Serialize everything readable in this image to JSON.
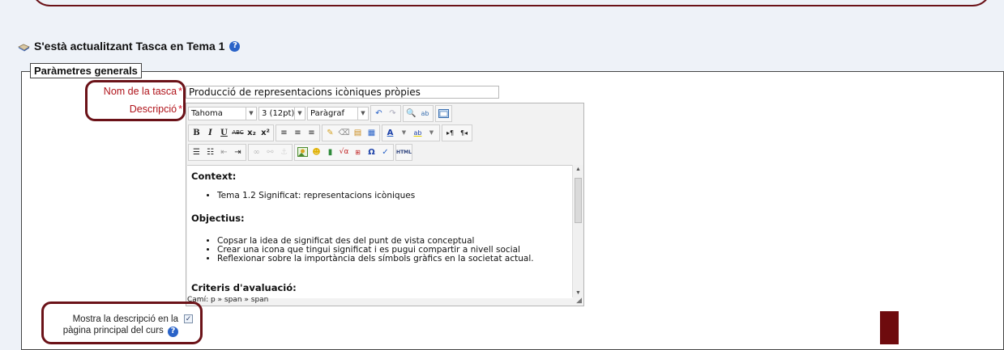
{
  "page": {
    "heading": "S'està actualitzant Tasca en Tema 1",
    "fieldset_legend": "Paràmetres generals"
  },
  "form": {
    "name_label": "Nom de la tasca",
    "name_required": "*",
    "name_value": "Producció de representacions icòniques pròpies",
    "description_label": "Descripció",
    "description_required": "*",
    "show_description_label_line1": "Mostra la descripció en la",
    "show_description_label_line2": "pàgina principal del curs",
    "show_description_checked": true
  },
  "editor": {
    "toolbar": {
      "font_family": "Tahoma",
      "font_size": "3 (12pt)",
      "block_format": "Paràgraf"
    },
    "content": {
      "section1_heading": "Context:",
      "section1_items": [
        "Tema 1.2 Significat: representacions icòniques"
      ],
      "section2_heading": "Objectius:",
      "section2_items": [
        "Copsar la idea de significat des del punt de vista conceptual",
        "Crear una icona que tingui significat i es pugui compartir a nivell social",
        "Reflexionar sobre la importància dels símbols gràfics en la societat actual."
      ],
      "section3_heading": "Criteris d'avaluació:"
    },
    "status_path": "Camí: p » span » span"
  },
  "colors": {
    "annotation_oval": "#6b1218",
    "required_label": "#b0131a",
    "help_icon": "#2a63c8"
  }
}
